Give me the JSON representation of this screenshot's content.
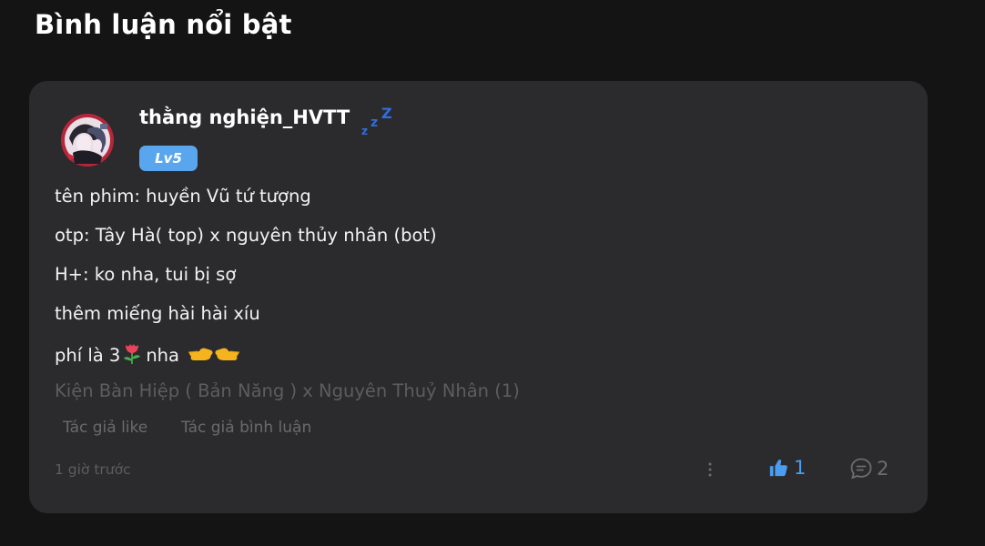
{
  "section": {
    "title": "Bình luận nổi bật"
  },
  "comment": {
    "username": "thằng nghiện_HVTT",
    "level": "Lv5",
    "lines": [
      "tên phim: huyền Vũ tứ tượng",
      "otp: Tây Hà( top) x nguyên thủy nhân (bot)",
      "H+: ko nha, tui bị sợ",
      "thêm miếng hài hài xíu"
    ],
    "price_prefix": "phí là 3",
    "price_suffix": "nha",
    "reply_to_title": "Kiện Bàn Hiệp ( Bản Năng ) x Nguyên Thuỷ Nhân (1)",
    "author_like_label": "Tác giả like",
    "author_comment_label": "Tác giả bình luận",
    "time": "1 giờ trước",
    "like_count": "1",
    "reply_count": "2"
  },
  "icons": {
    "more": "more-vertical-icon",
    "like": "thumbs-up-icon",
    "reply": "comment-bubble-icon",
    "zzz": "sleeping-zzz-icon",
    "tulip": "tulip-icon",
    "pointing": "pointing-hands-icon"
  },
  "colors": {
    "background": "#141414",
    "card": "#2b2b2d",
    "badge": "#5aa6ee",
    "like_active": "#4a9df0",
    "muted_text": "#5d5d60"
  }
}
